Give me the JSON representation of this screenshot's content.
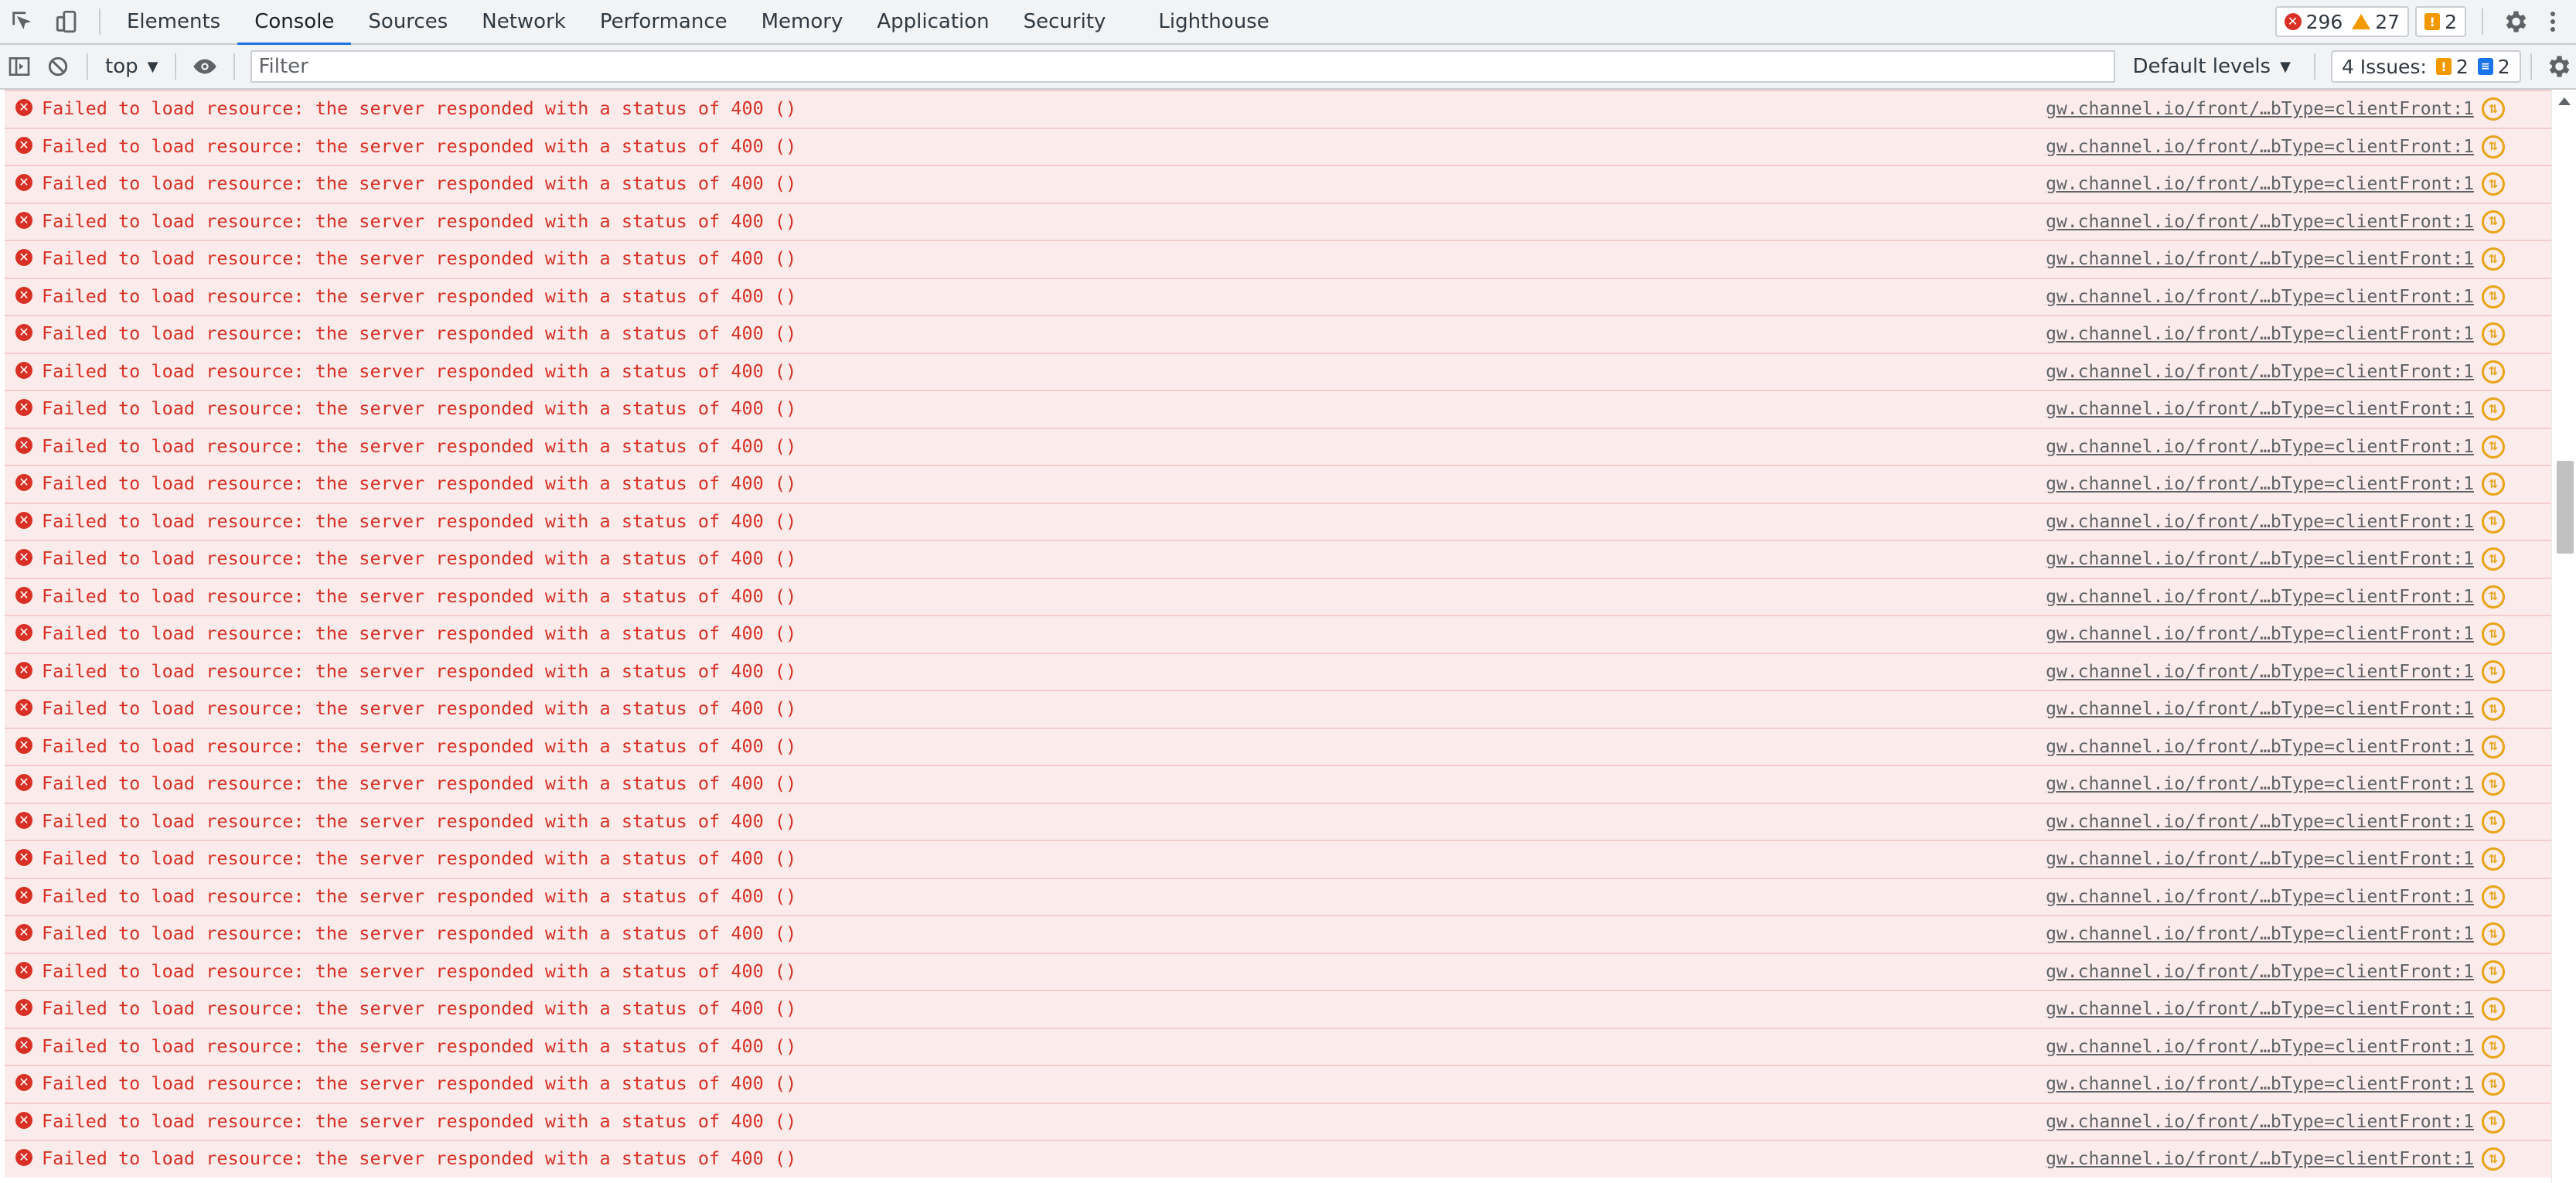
{
  "tabs": [
    {
      "label": "Elements"
    },
    {
      "label": "Console",
      "active": true
    },
    {
      "label": "Sources"
    },
    {
      "label": "Network"
    },
    {
      "label": "Performance"
    },
    {
      "label": "Memory"
    },
    {
      "label": "Application"
    },
    {
      "label": "Security"
    },
    {
      "label": "Lighthouse"
    }
  ],
  "counters": {
    "errors": "296",
    "warnings": "27",
    "issues": "2"
  },
  "toolbar": {
    "context": "top",
    "filter_placeholder": "Filter",
    "levels_label": "Default levels",
    "issues_label": "4 Issues:",
    "issues_warning_count": "2",
    "issues_info_count": "2"
  },
  "message": {
    "text": "Failed to load resource: the server responded with a status of 400 ()",
    "source": "gw.channel.io/front/…bType=clientFront:1",
    "count": 29
  },
  "colors": {
    "error_text": "#d93025",
    "error_bg": "#fcebeb",
    "accent": "#1a73e8",
    "warning": "#f29900"
  },
  "icons": {
    "inspect": "inspect-element-icon",
    "device": "device-toolbar-icon",
    "sidebar": "show-sidebar-icon",
    "clear": "clear-console-icon",
    "live_expression": "eye-icon",
    "settings": "gear-icon",
    "more": "kebab-menu-icon",
    "error": "error-circle-icon",
    "network": "network-request-icon"
  }
}
